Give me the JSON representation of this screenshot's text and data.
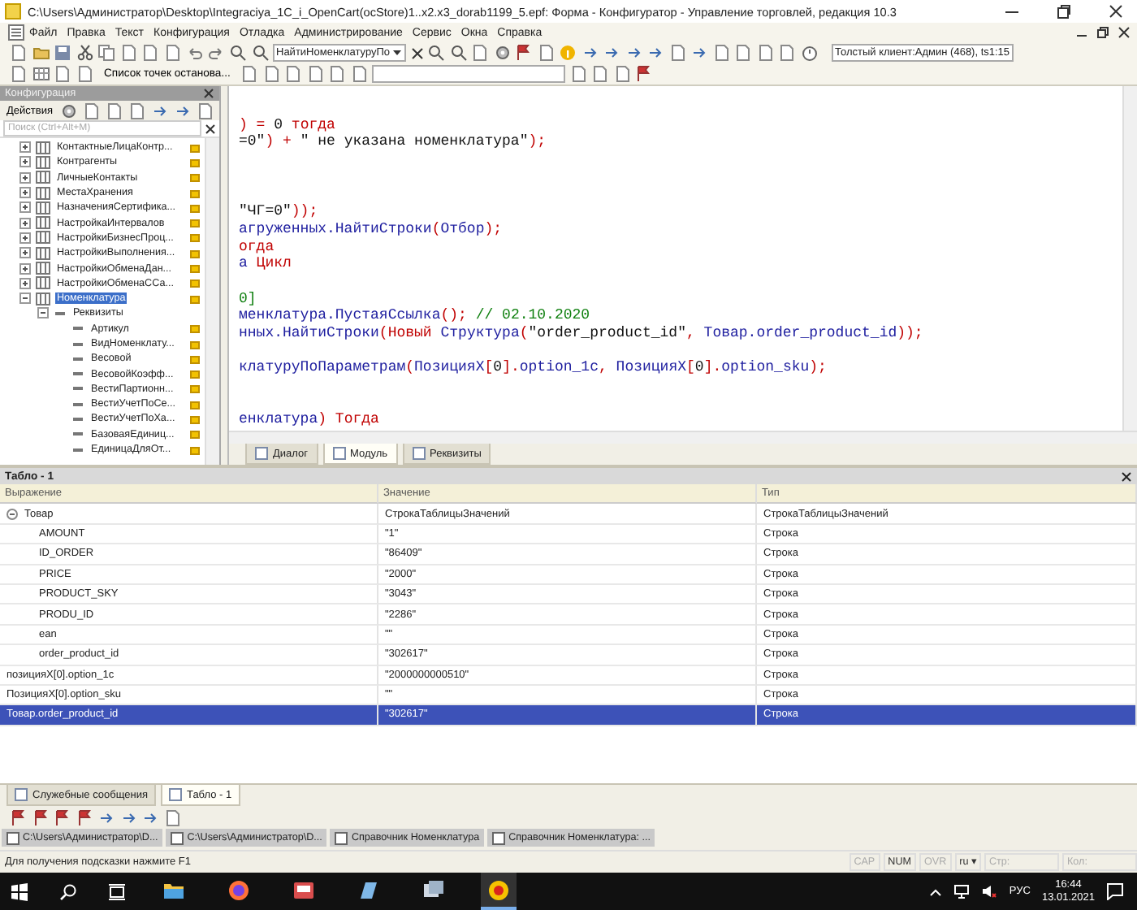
{
  "window": {
    "title": "C:\\Users\\Администратор\\Desktop\\Integraciya_1C_i_OpenCart(ocStore)1..x2.x3_dorab1199_5.epf: Форма - Конфигуратор - Управление торговлей, редакция 10.3"
  },
  "menu": [
    "Файл",
    "Правка",
    "Текст",
    "Конфигурация",
    "Отладка",
    "Администрирование",
    "Сервис",
    "Окна",
    "Справка"
  ],
  "toolbar": {
    "search_value": "НайтиНоменклатуруПо",
    "client": "Толстый клиент:Админ (468), ts1:15",
    "breakpoints": "Список точек останова..."
  },
  "config_panel": {
    "title": "Конфигурация",
    "actions": "Действия",
    "search_placeholder": "Поиск (Ctrl+Alt+M)",
    "tree": [
      {
        "label": "КонтактныеЛицаКонтр...",
        "kind": "object",
        "expanded": false,
        "selected": false
      },
      {
        "label": "Контрагенты",
        "kind": "object",
        "expanded": false,
        "selected": false
      },
      {
        "label": "ЛичныеКонтакты",
        "kind": "object",
        "expanded": false,
        "selected": false
      },
      {
        "label": "МестаХранения",
        "kind": "object",
        "expanded": false,
        "selected": false
      },
      {
        "label": "НазначенияСертифика...",
        "kind": "object",
        "expanded": false,
        "selected": false
      },
      {
        "label": "НастройкаИнтервалов",
        "kind": "object",
        "expanded": false,
        "selected": false
      },
      {
        "label": "НастройкиБизнесПроц...",
        "kind": "object",
        "expanded": false,
        "selected": false
      },
      {
        "label": "НастройкиВыполнения...",
        "kind": "object",
        "expanded": false,
        "selected": false
      },
      {
        "label": "НастройкиОбменаДан...",
        "kind": "object",
        "expanded": false,
        "selected": false
      },
      {
        "label": "НастройкиОбменаССа...",
        "kind": "object",
        "expanded": false,
        "selected": false
      },
      {
        "label": "Номенклатура",
        "kind": "object",
        "expanded": true,
        "selected": true,
        "children": [
          {
            "label": "Реквизиты",
            "kind": "group",
            "expanded": true,
            "selected": false,
            "children": [
              {
                "label": "Артикул",
                "kind": "attribute",
                "selected": false
              },
              {
                "label": "ВидНоменклату...",
                "kind": "attribute",
                "selected": false
              },
              {
                "label": "Весовой",
                "kind": "attribute",
                "selected": false
              },
              {
                "label": "ВесовойКоэфф...",
                "kind": "attribute",
                "selected": false
              },
              {
                "label": "ВестиПартионн...",
                "kind": "attribute",
                "selected": false
              },
              {
                "label": "ВестиУчетПоСе...",
                "kind": "attribute",
                "selected": false
              },
              {
                "label": "ВестиУчетПоХа...",
                "kind": "attribute",
                "selected": false
              },
              {
                "label": "БазоваяЕдиниц...",
                "kind": "attribute",
                "selected": false
              },
              {
                "label": "ЕдиницаДляОт...",
                "kind": "attribute",
                "selected": false
              }
            ]
          }
        ]
      }
    ]
  },
  "editor": {
    "lines": [
      {
        "kind": "blank"
      },
      {
        "kind": "code",
        "segments": [
          {
            "t": ") = ",
            "kind": "op"
          },
          {
            "t": "0",
            "kind": "num"
          },
          {
            "t": " тогда",
            "kind": "kw"
          }
        ]
      },
      {
        "kind": "code",
        "segments": [
          {
            "t": "=0\"",
            "kind": "str"
          },
          {
            "t": ") + ",
            "kind": "op"
          },
          {
            "t": "\" не указана номенклатура\"",
            "kind": "str"
          },
          {
            "t": ");",
            "kind": "op"
          }
        ]
      },
      {
        "kind": "blank"
      },
      {
        "kind": "blank"
      },
      {
        "kind": "blank"
      },
      {
        "kind": "code",
        "segments": [
          {
            "t": "\"ЧГ=0\"",
            "kind": "str"
          },
          {
            "t": "));",
            "kind": "op"
          }
        ]
      },
      {
        "kind": "code",
        "segments": [
          {
            "t": "агруженных.НайтиСтроки",
            "kind": "id"
          },
          {
            "t": "(",
            "kind": "op"
          },
          {
            "t": "Отбор",
            "kind": "id"
          },
          {
            "t": ");",
            "kind": "op"
          }
        ]
      },
      {
        "kind": "code",
        "segments": [
          {
            "t": "огда",
            "kind": "kw"
          }
        ]
      },
      {
        "kind": "code",
        "segments": [
          {
            "t": "а ",
            "kind": "id"
          },
          {
            "t": "Цикл",
            "kind": "kw"
          }
        ]
      },
      {
        "kind": "blank"
      },
      {
        "kind": "code",
        "segments": [
          {
            "t": "0]",
            "kind": "comment"
          }
        ]
      },
      {
        "kind": "code",
        "segments": [
          {
            "t": "менклатура.ПустаяСсылка",
            "kind": "id"
          },
          {
            "t": "();",
            "kind": "op"
          },
          {
            "t": " // 02.10.2020",
            "kind": "comment"
          }
        ]
      },
      {
        "kind": "code",
        "segments": [
          {
            "t": "нных.НайтиСтроки",
            "kind": "id"
          },
          {
            "t": "(",
            "kind": "op"
          },
          {
            "t": "Новый",
            "kind": "kw"
          },
          {
            "t": " Структура",
            "kind": "id"
          },
          {
            "t": "(",
            "kind": "op"
          },
          {
            "t": "\"order_product_id\"",
            "kind": "str"
          },
          {
            "t": ", ",
            "kind": "op"
          },
          {
            "t": "Товар.order_product_id",
            "kind": "id"
          },
          {
            "t": "));",
            "kind": "op"
          }
        ]
      },
      {
        "kind": "blank"
      },
      {
        "kind": "code",
        "segments": [
          {
            "t": "клатуруПоПараметрам",
            "kind": "id"
          },
          {
            "t": "(",
            "kind": "op"
          },
          {
            "t": "ПозицияX",
            "kind": "id"
          },
          {
            "t": "[",
            "kind": "op"
          },
          {
            "t": "0",
            "kind": "num"
          },
          {
            "t": "].",
            "kind": "op"
          },
          {
            "t": "option_1c",
            "kind": "id"
          },
          {
            "t": ", ",
            "kind": "op"
          },
          {
            "t": "ПозицияX",
            "kind": "id"
          },
          {
            "t": "[",
            "kind": "op"
          },
          {
            "t": "0",
            "kind": "num"
          },
          {
            "t": "].",
            "kind": "op"
          },
          {
            "t": "option_sku",
            "kind": "id"
          },
          {
            "t": ");",
            "kind": "op"
          }
        ]
      },
      {
        "kind": "blank"
      },
      {
        "kind": "blank"
      },
      {
        "kind": "code",
        "segments": [
          {
            "t": "енклатура",
            "kind": "id"
          },
          {
            "t": ") ",
            "kind": "op"
          },
          {
            "t": "Тогда",
            "kind": "kw"
          }
        ]
      }
    ],
    "tabs": [
      {
        "label": "Диалог",
        "selected": false
      },
      {
        "label": "Модуль",
        "selected": true
      },
      {
        "label": "Реквизиты",
        "selected": false
      }
    ]
  },
  "watch": {
    "title": "Табло - 1",
    "columns": [
      "Выражение",
      "Значение",
      "Тип"
    ],
    "rows": [
      {
        "cells": [
          "Товар",
          "СтрокаТаблицыЗначений",
          "СтрокаТаблицыЗначений"
        ],
        "expanded": true,
        "selected": false,
        "children": [
          {
            "cells": [
              "AMOUNT",
              "\"1\"",
              "Строка"
            ],
            "selected": false
          },
          {
            "cells": [
              "ID_ORDER",
              "\"86409\"",
              "Строка"
            ],
            "selected": false
          },
          {
            "cells": [
              "PRICE",
              "\"2000\"",
              "Строка"
            ],
            "selected": false
          },
          {
            "cells": [
              "PRODUCT_SKY",
              "\"3043\"",
              "Строка"
            ],
            "selected": false
          },
          {
            "cells": [
              "PRODU_ID",
              "\"2286\"",
              "Строка"
            ],
            "selected": false
          },
          {
            "cells": [
              "ean",
              "\"\"",
              "Строка"
            ],
            "selected": false
          },
          {
            "cells": [
              "order_product_id",
              "\"302617\"",
              "Строка"
            ],
            "selected": false
          }
        ]
      },
      {
        "cells": [
          "позицияX[0].option_1c",
          "\"2000000000510\"",
          "Строка"
        ],
        "selected": false
      },
      {
        "cells": [
          "ПозицияX[0].option_sku",
          "\"\"",
          "Строка"
        ],
        "selected": false
      },
      {
        "cells": [
          "Товар.order_product_id",
          "\"302617\"",
          "Строка"
        ],
        "selected": true
      }
    ]
  },
  "bottom_tabs": [
    {
      "label": "Служебные сообщения",
      "selected": false
    },
    {
      "label": "Табло - 1",
      "selected": true
    }
  ],
  "open_windows": [
    "C:\\Users\\Администратор\\D...",
    "C:\\Users\\Администратор\\D...",
    "Справочник Номенклатура",
    "Справочник Номенклатура: ..."
  ],
  "status_bar": {
    "hint": "Для получения подсказки нажмите F1",
    "indicators": [
      {
        "label": "CAP",
        "on": false
      },
      {
        "label": "NUM",
        "on": true
      },
      {
        "label": "OVR",
        "on": false
      }
    ],
    "language": "ru ▾",
    "row": "Стр:",
    "col": "Кол:"
  },
  "taskbar": {
    "language": "РУС",
    "time": "16:44",
    "date": "13.01.2021"
  }
}
